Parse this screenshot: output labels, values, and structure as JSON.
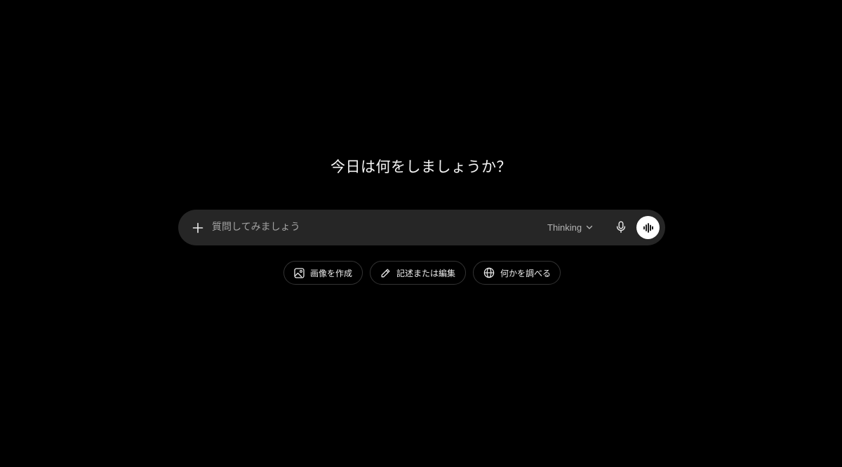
{
  "main": {
    "greeting": "今日は何をしましょうか？"
  },
  "composer": {
    "placeholder": "質問してみましょう",
    "value": "",
    "model_label": "Thinking",
    "icons": {
      "attach": "plus-icon",
      "model_dropdown": "chevron-down-icon",
      "dictate": "microphone-icon",
      "voice_mode": "waveform-icon"
    }
  },
  "suggestions": [
    {
      "label": "画像を作成",
      "icon": "image-icon"
    },
    {
      "label": "記述または編集",
      "icon": "pencil-icon"
    },
    {
      "label": "何かを調べる",
      "icon": "globe-icon"
    }
  ],
  "colors": {
    "background": "#000000",
    "composer_background": "#262626",
    "chip_border": "#333333",
    "voice_button": "#ffffff",
    "text": "#ececec",
    "placeholder": "#a3a3a3"
  }
}
